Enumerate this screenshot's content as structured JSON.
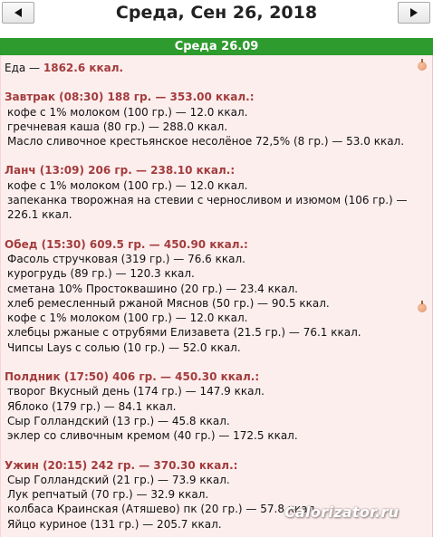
{
  "header": {
    "prev_symbol": "◄",
    "next_symbol": "►",
    "title": "Среда, Сен 26, 2018"
  },
  "day_bar": {
    "label": "Среда 26.09"
  },
  "total": {
    "prefix": "Еда — ",
    "value": "1862.6 ккал."
  },
  "meals": [
    {
      "header": "Завтрак (08:30) 188 гр. — 353.00 ккал.:",
      "items": [
        "кофе с 1% молоком (100 гр.) — 12.0 ккал.",
        "гречневая каша (80 гр.) — 288.0 ккал.",
        "Масло сливочное крестьянское несолёное 72,5% (8 гр.) — 53.0 ккал."
      ]
    },
    {
      "header": "Ланч (13:09) 206 гр. — 238.10 ккал.:",
      "items": [
        "кофе с 1% молоком (100 гр.) — 12.0 ккал.",
        "запеканка творожная на стевии с черносливом и изюмом (106 гр.) —",
        "226.1 ккал."
      ]
    },
    {
      "header": "Обед (15:30) 609.5 гр. — 450.90 ккал.:",
      "items": [
        "Фасоль стручковая (319 гр.) — 76.6 ккал.",
        "курогрудь (89 гр.) — 120.3 ккал.",
        "сметана 10% Простоквашино (20 гр.) — 23.4 ккал.",
        "хлеб ремесленный ржаной Мяснов (50 гр.) — 90.5 ккал.",
        "кофе с 1% молоком (100 гр.) — 12.0 ккал.",
        "хлебцы ржаные с отрубями Елизавета (21.5 гр.) — 76.1 ккал.",
        "Чипсы Lays с солью (10 гр.) — 52.0 ккал."
      ]
    },
    {
      "header": "Полдник (17:50) 406 гр. — 450.30 ккал.:",
      "items": [
        "творог Вкусный день (174 гр.) — 147.9 ккал.",
        "Яблоко (179 гр.) — 84.1 ккал.",
        "Сыр Голландский (13 гр.) — 45.8 ккал.",
        "эклер со сливочным кремом (40 гр.) — 172.5 ккал."
      ]
    },
    {
      "header": "Ужин (20:15) 242 гр. — 370.30 ккал.:",
      "items": [
        "Сыр Голландский (21 гр.) — 73.9 ккал.",
        "Лук репчатый (70 гр.) — 32.9 ккал.",
        "колбаса Краинская (Атяшево) пк (20 гр.) — 57.8 ккал.",
        "Яйцо куриное (131 гр.) — 205.7 ккал."
      ]
    }
  ],
  "watermark": "Calorizator.ru",
  "colors": {
    "accent_green": "#2e9b2e",
    "panel_bg": "#fdeeee",
    "meal_header": "#a33c3c"
  }
}
